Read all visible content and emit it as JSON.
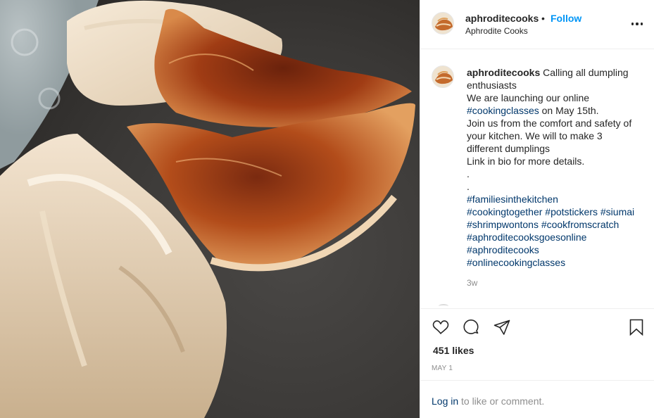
{
  "post_image": {
    "description_icon": "food-photo-icon"
  },
  "header": {
    "username": "aphroditecooks",
    "separator": "•",
    "follow_label": "Follow",
    "subtitle": "Aphrodite Cooks",
    "more_icon": "more-dots-icon"
  },
  "caption": {
    "username": "aphroditecooks",
    "lines": [
      "Calling all dumpling",
      "enthusiasts",
      "We are launching our online",
      "#cookingclasses",
      "on May 15th.",
      "Join us from the comfort and safety of",
      "your kitchen. We will to make 3",
      "different dumplings",
      "Link in bio for more details.",
      ".",
      ".",
      "#familiesinthekitchen",
      "#cookingtogether #potstickers #siumai",
      "#shrimpwontons #cookfromscratch",
      "#aphroditecooksgoesonline",
      "#aphroditecooks",
      "#onlinecookingclasses"
    ],
    "timestamp": "3w"
  },
  "actions": {
    "icons": [
      "heart-icon",
      "comment-icon",
      "share-icon",
      "bookmark-icon"
    ],
    "likes": "451 likes",
    "date": "MAY 1"
  },
  "login": {
    "link": "Log in",
    "rest": "to like or comment."
  },
  "colors": {
    "link_blue": "#0095f6",
    "hashtag": "#00376b",
    "muted": "#8e8e8e",
    "text": "#262626",
    "border": "#efefef"
  }
}
